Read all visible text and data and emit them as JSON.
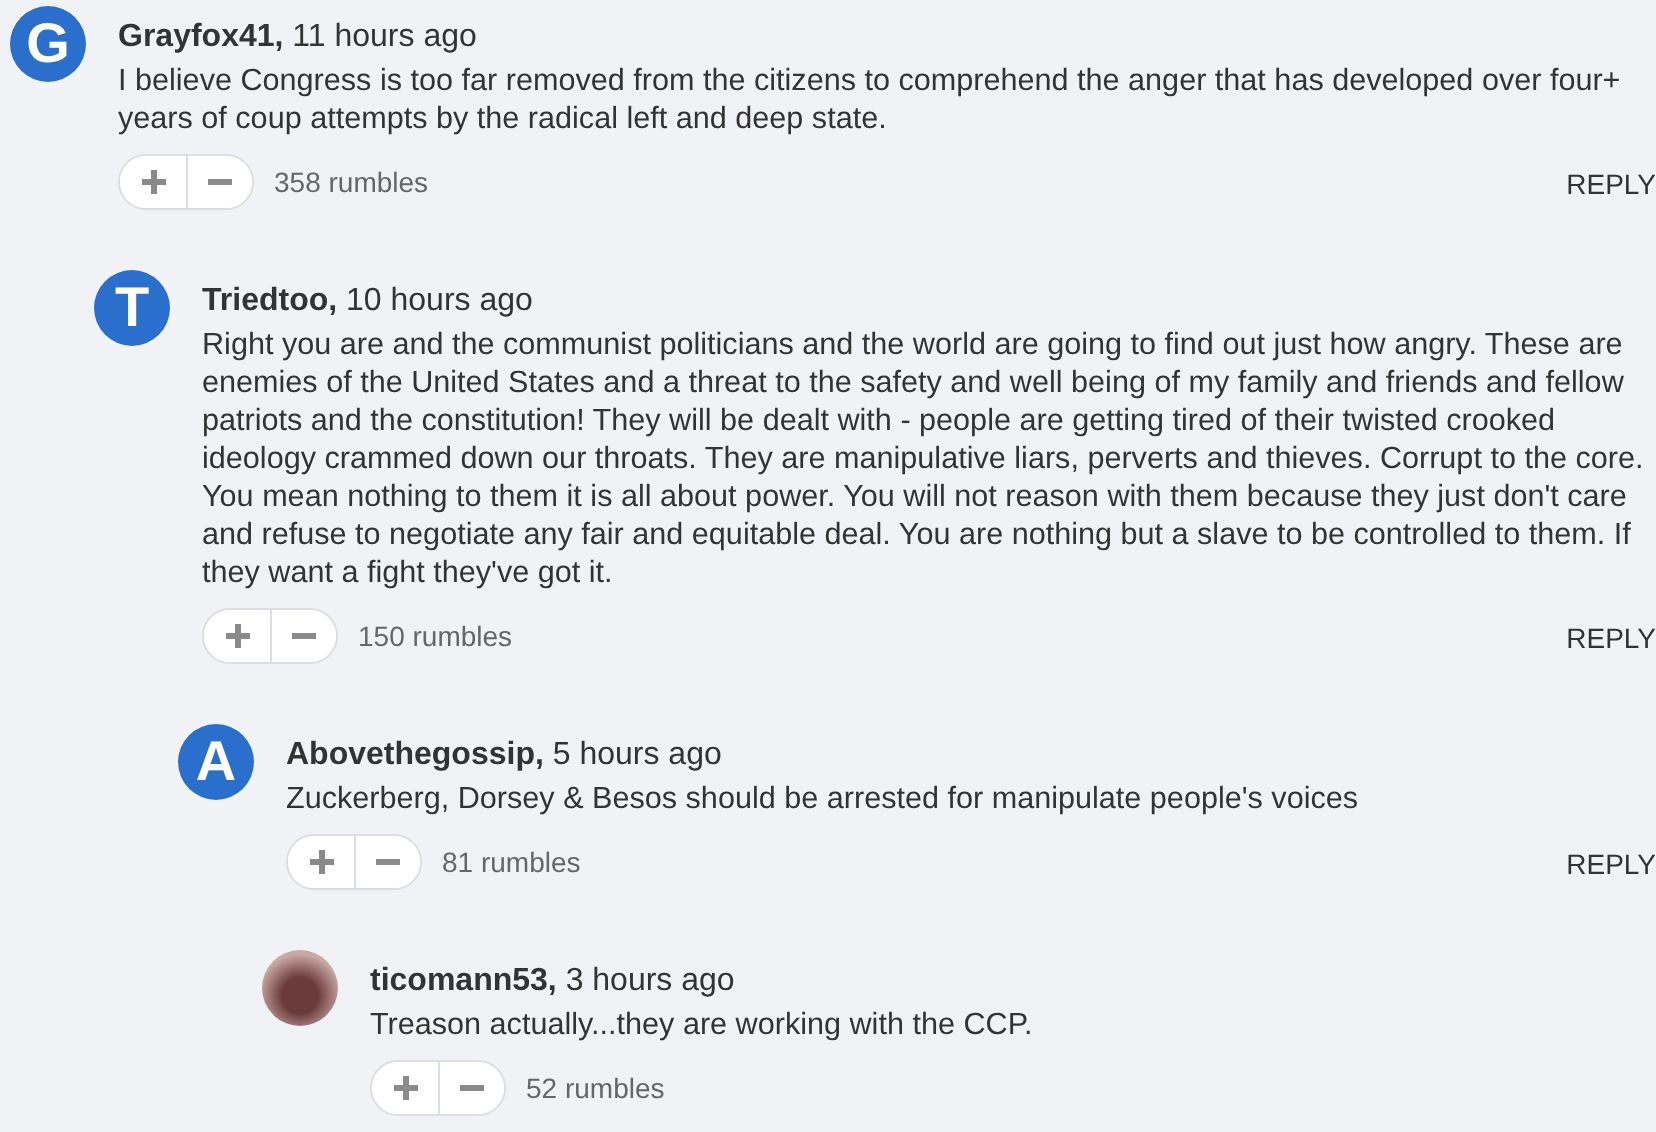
{
  "comments": [
    {
      "avatar": {
        "kind": "letter",
        "initial": "G"
      },
      "author": "Grayfox41,",
      "time": "11 hours ago",
      "text": "I believe Congress is too far removed from the citizens to comprehend the anger that has developed over four+ years of coup attempts by the radical left and deep state.",
      "rumbles": "358 rumbles",
      "reply": "REPLY",
      "children": [
        {
          "avatar": {
            "kind": "letter",
            "initial": "T"
          },
          "author": "Triedtoo,",
          "time": "10 hours ago",
          "text": "Right you are and the communist politicians and the world are going to find out just how angry. These are enemies of the United States and a threat to the safety and well being of my family and friends and fellow patriots and the constitution! They will be dealt with - people are getting tired of their twisted crooked ideology crammed down our throats. They are manipulative liars, perverts and thieves. Corrupt to the core. You mean nothing to them it is all about power. You will not reason with them because they just don't care and refuse to negotiate any fair and equitable deal. You are nothing but a slave to be controlled to them. If they want a fight they've got it.",
          "rumbles": "150 rumbles",
          "reply": "REPLY",
          "children": [
            {
              "avatar": {
                "kind": "letter",
                "initial": "A"
              },
              "author": "Abovethegossip,",
              "time": "5 hours ago",
              "text": "Zuckerberg, Dorsey & Besos should be arrested for manipulate people's voices",
              "rumbles": "81 rumbles",
              "reply": "REPLY",
              "children": [
                {
                  "avatar": {
                    "kind": "photo"
                  },
                  "author": "ticomann53,",
                  "time": "3 hours ago",
                  "text": "Treason actually...they are working with the CCP.",
                  "rumbles": "52 rumbles"
                }
              ]
            }
          ]
        }
      ]
    }
  ]
}
